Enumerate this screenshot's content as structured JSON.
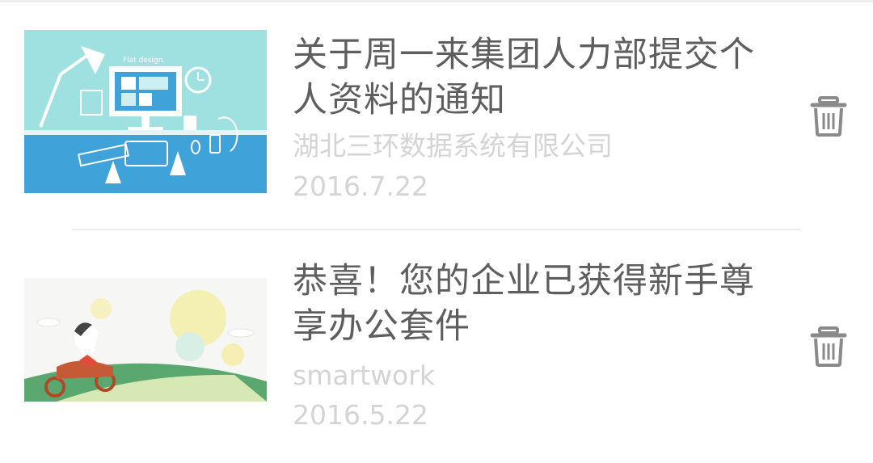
{
  "notices": [
    {
      "title": "关于周一来集团人力部提交个人资料的通知",
      "source": "湖北三环数据系统有限公司",
      "date": "2016.7.22",
      "thumbnail_icon": "flat-design-desk-illustration",
      "thumbnail_text": "Flat design",
      "delete_icon": "trash-icon"
    },
    {
      "title": "恭喜！您的企业已获得新手尊享办公套件",
      "source": "smartwork",
      "date": "2016.5.22",
      "thumbnail_icon": "girl-on-scooter-illustration",
      "delete_icon": "trash-icon"
    }
  ],
  "colors": {
    "title": "#5e5e5e",
    "meta": "#d4d4d4",
    "divider": "#ebebeb",
    "icon": "#8a8a8a"
  }
}
